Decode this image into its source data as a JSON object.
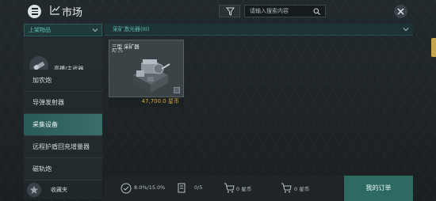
{
  "header": {
    "title": "市场",
    "search_placeholder": "请输入搜索内容",
    "icons": [
      "menu-icon",
      "chart-icon",
      "filter-icon",
      "search-icon",
      "close-icon"
    ]
  },
  "sidebar": {
    "header_label": "上架物品",
    "weapon_label": "高槽/主武器",
    "items": [
      {
        "label": "加农炮",
        "active": false
      },
      {
        "label": "导弹发射器",
        "active": false
      },
      {
        "label": "采集设备",
        "active": true
      },
      {
        "label": "远程护盾回充增量器",
        "active": false
      },
      {
        "label": "磁轨炮",
        "active": false
      }
    ],
    "favorites_label": "收藏夹"
  },
  "main": {
    "category_label": "采矿激光器(III)",
    "cards": [
      {
        "name": "三型 采矿器",
        "subtitle": "A/ /S",
        "price": "47,700.0 星币"
      }
    ]
  },
  "footer": {
    "tax": "8.0%/15.0%",
    "orders_count": "0/5",
    "sell_value": "0 星币",
    "buy_value": "0 星币",
    "my_orders_label": "我的订单"
  },
  "colors": {
    "accent_teal": "#2e6a62",
    "active_item": "#3a6e6b",
    "price_gold": "#d4a43c",
    "side_tab": "#c5a64d"
  }
}
